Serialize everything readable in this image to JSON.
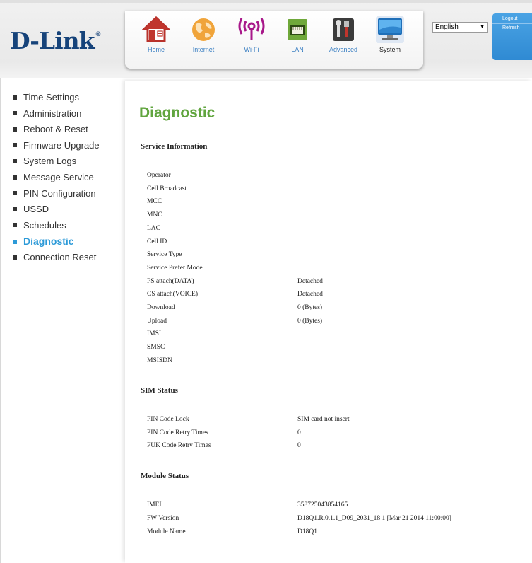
{
  "brand": {
    "logo_text": "D-Link",
    "registered_mark": "®"
  },
  "nav": {
    "items": [
      {
        "label": "Home",
        "icon": "home-icon"
      },
      {
        "label": "Internet",
        "icon": "globe-icon"
      },
      {
        "label": "Wi-Fi",
        "icon": "wifi-icon"
      },
      {
        "label": "LAN",
        "icon": "lan-icon"
      },
      {
        "label": "Advanced",
        "icon": "tools-icon"
      },
      {
        "label": "System",
        "icon": "computer-icon"
      }
    ],
    "active": "System"
  },
  "language": {
    "selected": "English"
  },
  "user": {
    "logout_label": "Logout",
    "refresh_label": "Refresh"
  },
  "sidebar": {
    "items": [
      {
        "label": "Time Settings"
      },
      {
        "label": "Administration"
      },
      {
        "label": "Reboot & Reset"
      },
      {
        "label": "Firmware Upgrade"
      },
      {
        "label": "System Logs"
      },
      {
        "label": "Message Service"
      },
      {
        "label": "PIN Configuration"
      },
      {
        "label": "USSD"
      },
      {
        "label": "Schedules"
      },
      {
        "label": "Diagnostic"
      },
      {
        "label": "Connection Reset"
      }
    ],
    "active": "Diagnostic"
  },
  "page": {
    "title": "Diagnostic"
  },
  "service_info": {
    "heading": "Service Information",
    "rows": [
      {
        "label": "Operator",
        "value": ""
      },
      {
        "label": "Cell Broadcast",
        "value": ""
      },
      {
        "label": "MCC",
        "value": ""
      },
      {
        "label": "MNC",
        "value": ""
      },
      {
        "label": "LAC",
        "value": ""
      },
      {
        "label": "Cell ID",
        "value": ""
      },
      {
        "label": "Service Type",
        "value": ""
      },
      {
        "label": "Service Prefer Mode",
        "value": ""
      },
      {
        "label": "PS attach(DATA)",
        "value": "Detached"
      },
      {
        "label": "CS attach(VOICE)",
        "value": "Detached"
      },
      {
        "label": "Download",
        "value": "0 (Bytes)"
      },
      {
        "label": "Upload",
        "value": "0 (Bytes)"
      },
      {
        "label": "IMSI",
        "value": ""
      },
      {
        "label": "SMSC",
        "value": ""
      },
      {
        "label": "MSISDN",
        "value": ""
      }
    ]
  },
  "sim_status": {
    "heading": "SIM Status",
    "rows": [
      {
        "label": "PIN Code Lock",
        "value": "SIM card not insert"
      },
      {
        "label": "PIN Code Retry Times",
        "value": "0"
      },
      {
        "label": "PUK Code Retry Times",
        "value": "0"
      }
    ]
  },
  "module_status": {
    "heading": "Module Status",
    "rows": [
      {
        "label": "IMEI",
        "value": "358725043854165"
      },
      {
        "label": "FW Version",
        "value": "D18Q1.R.0.1.1_D09_2031_18 1 [Mar 21 2014 11:00:00]"
      },
      {
        "label": "Module Name",
        "value": "D18Q1"
      }
    ]
  },
  "colors": {
    "brand": "#16437a",
    "title_green": "#61a53f",
    "active_blue": "#2c9ad8",
    "nav_label_blue": "#3a7fc2"
  }
}
